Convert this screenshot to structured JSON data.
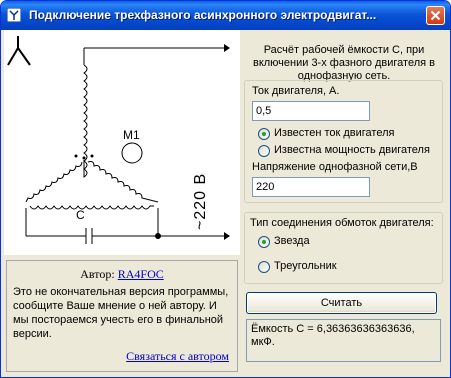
{
  "window": {
    "title": "Подключение трехфазного асинхронного электродвигат...",
    "close_label": "×"
  },
  "diagram": {
    "motor_label": "M1",
    "capacitor_label": "C",
    "voltage_label": "~220 В"
  },
  "author": {
    "prefix": "Автор:",
    "name": "RA4FOC",
    "message": "Это не окончательная версия программы, сообщите Ваше мнение о ней автору. И мы постораемся учесть его в финальной версии.",
    "contact_link": "Связаться с автором"
  },
  "calc": {
    "heading": "Расчёт рабочей ёмкости С, при включении 3-х фазного двигателя в однофазную сеть.",
    "current_label": "Ток двигателя, А.",
    "current_value": "0,5",
    "radio_current": "Известен ток двигателя",
    "radio_power": "Известна мощность двигателя",
    "voltage_label": "Напряжение однофазной сети,В",
    "voltage_value": "220",
    "connection_label": "Тип соединения обмоток двигателя:",
    "radio_star": "Звезда",
    "radio_triangle": "Треугольник",
    "button_label": "Считать",
    "result": "Ёмкость С = 6,36363636363636,\nмкФ."
  },
  "state": {
    "known_quantity": "current",
    "connection_type": "star"
  },
  "colors": {
    "titlebar": "#0a55d6",
    "link": "#0000cc",
    "radio_dot": "#21a121"
  }
}
